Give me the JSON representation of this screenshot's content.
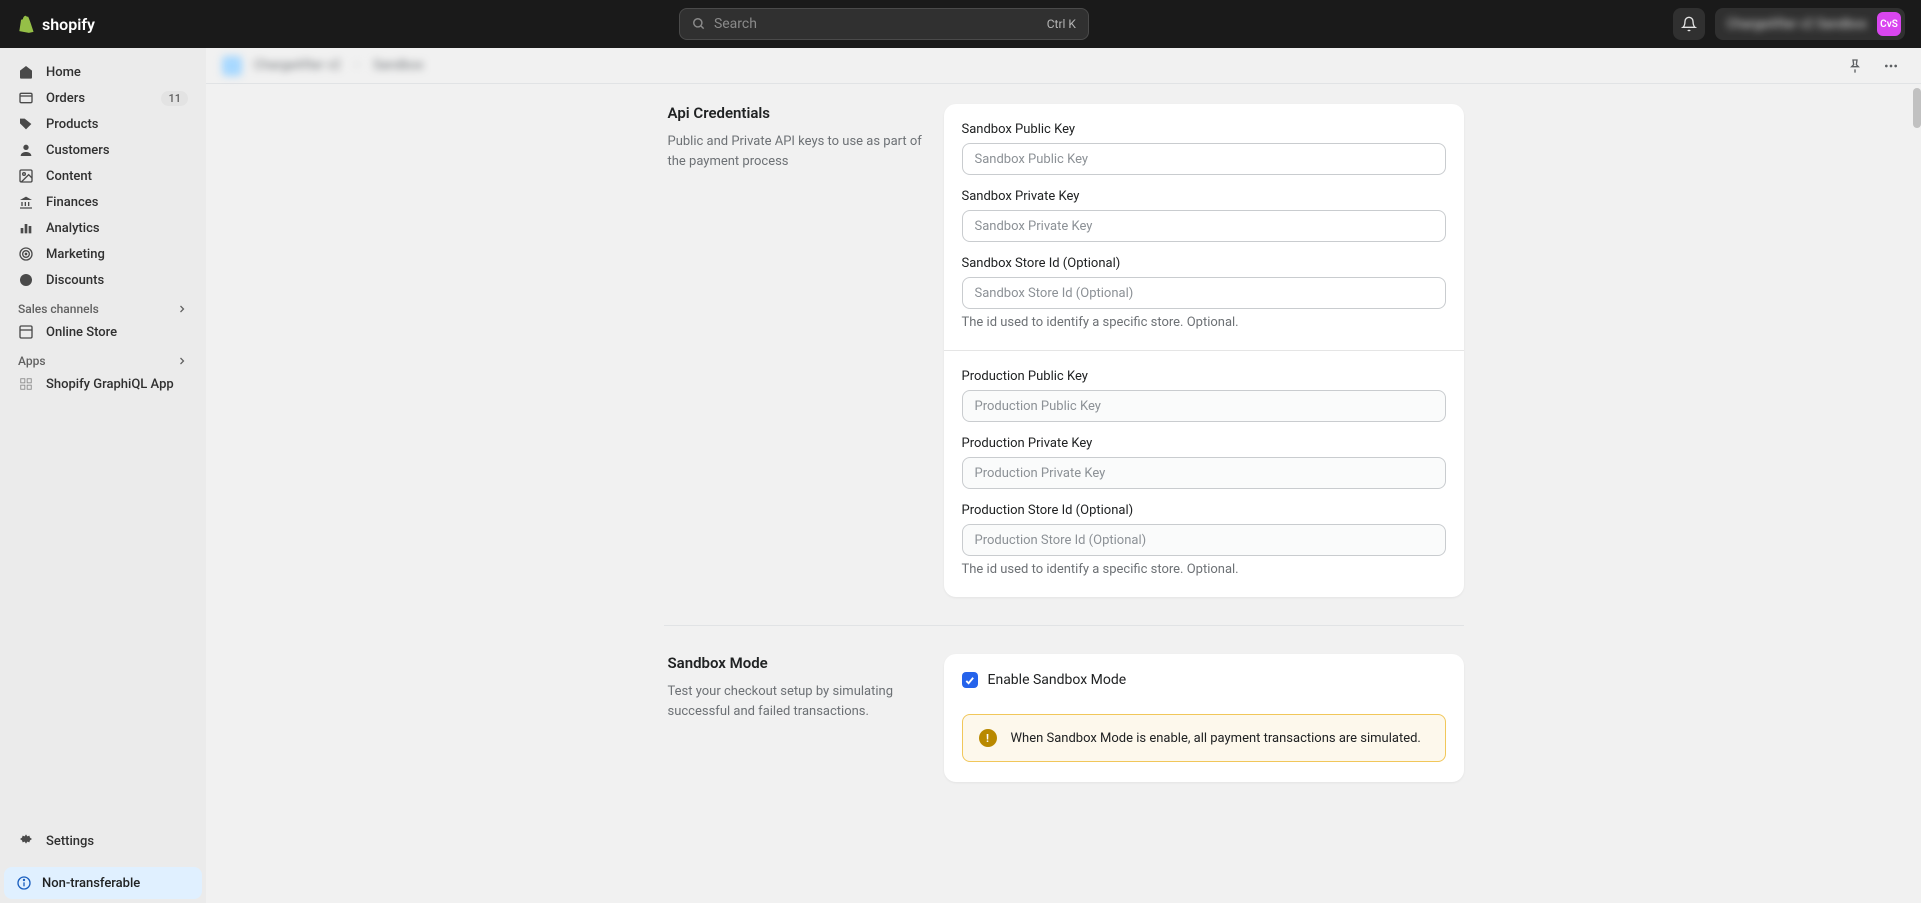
{
  "topbar": {
    "logo_text": "shopify",
    "search_placeholder": "Search",
    "search_shortcut": "Ctrl K",
    "store_name": "ChargeAfter v2 Sandbox",
    "avatar_initials": "CvS"
  },
  "sidebar": {
    "items": [
      {
        "label": "Home"
      },
      {
        "label": "Orders",
        "badge": "11"
      },
      {
        "label": "Products"
      },
      {
        "label": "Customers"
      },
      {
        "label": "Content"
      },
      {
        "label": "Finances"
      },
      {
        "label": "Analytics"
      },
      {
        "label": "Marketing"
      },
      {
        "label": "Discounts"
      }
    ],
    "sections": {
      "sales_channels": "Sales channels",
      "apps": "Apps"
    },
    "channels": [
      {
        "label": "Online Store"
      }
    ],
    "apps_items": [
      {
        "label": "Shopify GraphiQL App"
      }
    ],
    "settings": "Settings",
    "non_transferable": "Non-transferable"
  },
  "breadcrumb": {
    "app": "ChargeAfter v2",
    "page": "Sandbox"
  },
  "sections": {
    "api": {
      "title": "Api Credentials",
      "desc": "Public and Private API keys to use as part of the payment process",
      "fields": {
        "sandbox_public": {
          "label": "Sandbox Public Key",
          "placeholder": "Sandbox Public Key"
        },
        "sandbox_private": {
          "label": "Sandbox Private Key",
          "placeholder": "Sandbox Private Key"
        },
        "sandbox_store": {
          "label": "Sandbox Store Id (Optional)",
          "placeholder": "Sandbox Store Id (Optional)",
          "help": "The id used to identify a specific store. Optional."
        },
        "prod_public": {
          "label": "Production Public Key",
          "placeholder": "Production Public Key"
        },
        "prod_private": {
          "label": "Production Private Key",
          "placeholder": "Production Private Key"
        },
        "prod_store": {
          "label": "Production Store Id (Optional)",
          "placeholder": "Production Store Id (Optional)",
          "help": "The id used to identify a specific store. Optional."
        }
      }
    },
    "sandbox": {
      "title": "Sandbox Mode",
      "desc": "Test your checkout setup by simulating successful and failed transactions.",
      "checkbox_label": "Enable Sandbox Mode",
      "banner": "When Sandbox Mode is enable, all payment transactions are simulated."
    }
  }
}
